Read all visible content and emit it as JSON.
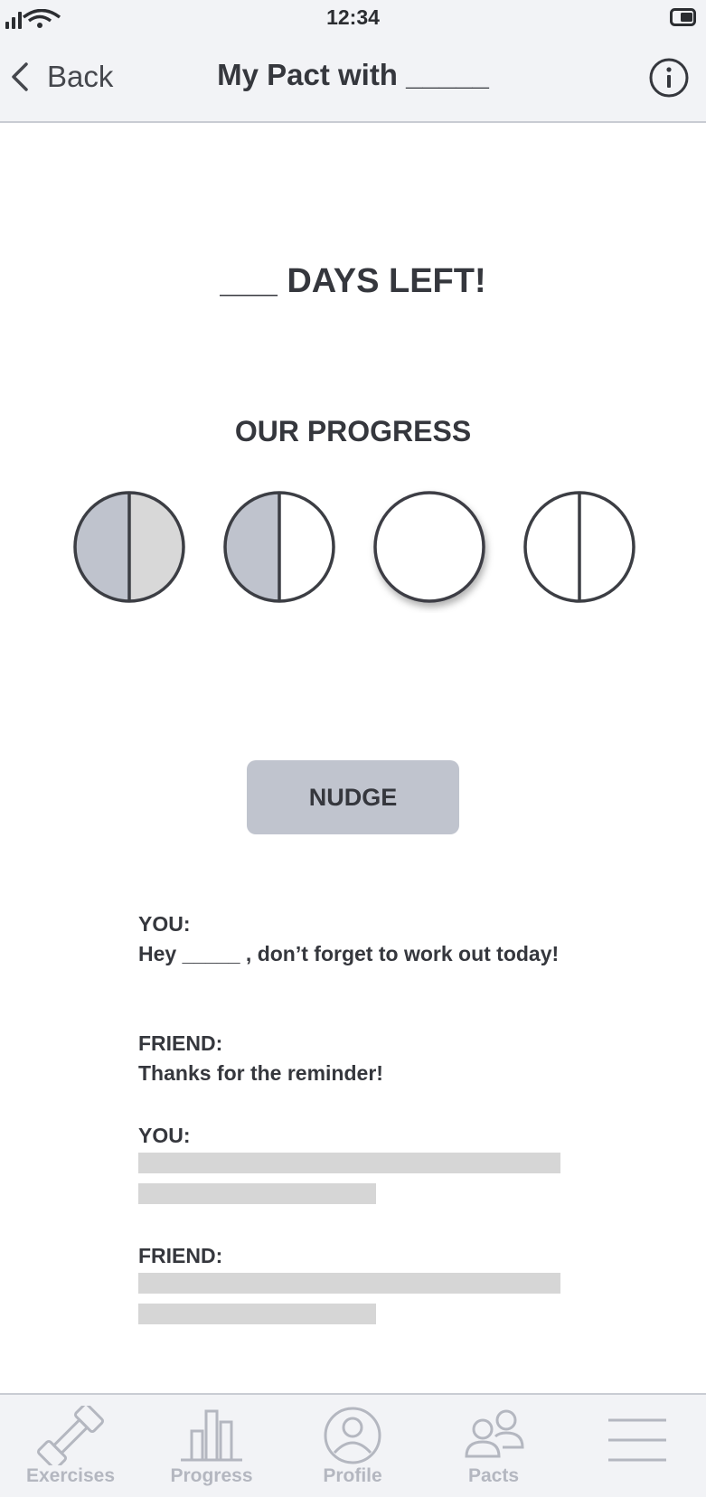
{
  "status_bar": {
    "time": "12:34"
  },
  "header": {
    "back_label": "Back",
    "title": "My Pact with _____"
  },
  "countdown": {
    "text": "___ DAYS LEFT!"
  },
  "progress": {
    "heading": "OUR PROGRESS",
    "circles": [
      {
        "left_filled": true,
        "right_filled": true,
        "divided": true,
        "highlighted": false
      },
      {
        "left_filled": true,
        "right_filled": false,
        "divided": true,
        "highlighted": false
      },
      {
        "left_filled": false,
        "right_filled": false,
        "divided": false,
        "highlighted": true
      },
      {
        "left_filled": false,
        "right_filled": false,
        "divided": true,
        "highlighted": false
      }
    ]
  },
  "nudge_button": {
    "label": "NUDGE"
  },
  "messages": [
    {
      "sender": "YOU:",
      "text": "Hey _____ , don’t forget to work out today!"
    },
    {
      "sender": "FRIEND:",
      "text": "Thanks for the reminder!"
    },
    {
      "sender": "YOU:",
      "text": ""
    },
    {
      "sender": "FRIEND:",
      "text": ""
    }
  ],
  "tabs": [
    {
      "label": "Exercises",
      "icon": "dumbbell-icon"
    },
    {
      "label": "Progress",
      "icon": "bar-chart-icon"
    },
    {
      "label": "Profile",
      "icon": "profile-icon"
    },
    {
      "label": "Pacts",
      "icon": "people-icon"
    },
    {
      "label": "",
      "icon": "menu-icon"
    }
  ],
  "colors": {
    "header_bg": "#f2f3f6",
    "text": "#35373d",
    "filled_half_left": "#bfc3cd",
    "filled_half_right": "#d8d8d8",
    "button_bg": "#c0c4ce",
    "placeholder_bar": "#d6d6d6",
    "tab_icon": "#b4b7c0"
  }
}
